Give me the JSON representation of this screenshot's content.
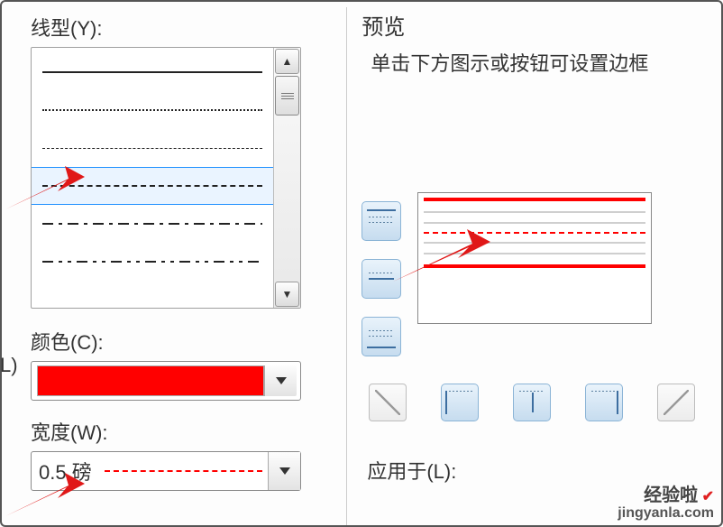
{
  "left": {
    "lineStyleLabel": "线型(Y):",
    "colorLabel": "颜色(C):",
    "widthLabel": "宽度(W):",
    "widthValue": "0.5  磅",
    "colorValue": "#ff0000",
    "selectedLineIndex": 4
  },
  "right": {
    "previewTitle": "预览",
    "previewDesc": "单击下方图示或按钮可设置边框",
    "applyToLabel": "应用于(L):"
  },
  "croppedLabel": "L)",
  "watermark": {
    "brand": "经验啦",
    "url": "jingyanla.com"
  }
}
